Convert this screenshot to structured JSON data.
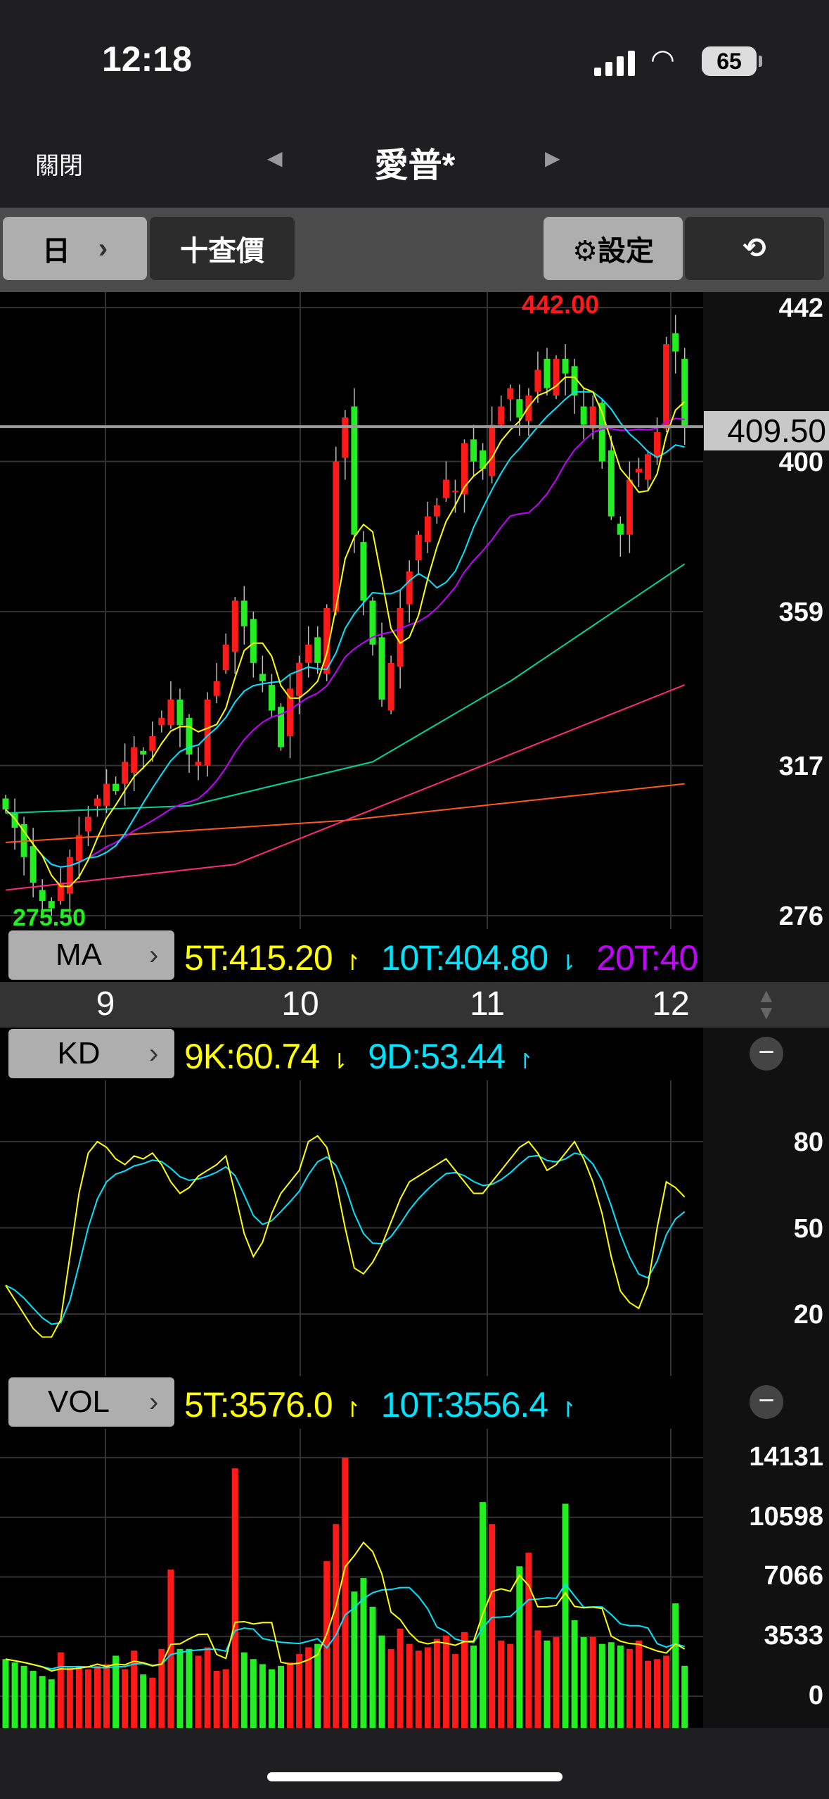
{
  "status": {
    "time": "12:18",
    "battery": "65"
  },
  "nav": {
    "close": "關閉",
    "title": "愛普*",
    "prev": "◀",
    "next": "▶"
  },
  "toolbar": {
    "period": "日",
    "period_arrow": "›",
    "add_price": "十查價",
    "settings": "⚙設定",
    "rotate": "⟲"
  },
  "price_axis": {
    "labels": [
      "442",
      "400",
      "359",
      "317",
      "276"
    ],
    "last": "409.50",
    "high_label": "442.00",
    "low_label": "275.50"
  },
  "ma": {
    "tag": "MA",
    "arrow": "›",
    "items": [
      {
        "text": "5T:415.20",
        "color": "#ffff00"
      },
      {
        "text": "10T:404.80",
        "color": "#00e5ff"
      },
      {
        "text": "20T:40",
        "color": "#c400ff"
      }
    ],
    "arrows": [
      "↾",
      "⇂",
      ""
    ]
  },
  "x_axis": {
    "labels": [
      "9",
      "10",
      "11",
      "12"
    ]
  },
  "kd": {
    "tag": "KD",
    "arrow": "›",
    "items": [
      {
        "text": "9K:60.74",
        "color": "#ffff00"
      },
      {
        "text": "9D:53.44",
        "color": "#00e5ff"
      }
    ],
    "arrows": [
      "⇂",
      "↾"
    ],
    "axis": [
      "80",
      "50",
      "20"
    ],
    "collapse": "−"
  },
  "vol": {
    "tag": "VOL",
    "arrow": "›",
    "items": [
      {
        "text": "5T:3576.0",
        "color": "#ffff00"
      },
      {
        "text": "10T:3556.4",
        "color": "#00e5ff"
      }
    ],
    "arrows": [
      "↾",
      "↾"
    ],
    "axis": [
      "14131",
      "10598",
      "7066",
      "3533",
      "0"
    ],
    "collapse": "−"
  },
  "colors": {
    "up": "#ff1a1a",
    "down": "#22ee22",
    "ma5": "#ffff00",
    "ma10": "#00e5ff",
    "ma20": "#c400ff",
    "ma60": "#00d49a",
    "ma120": "#ff2a7a",
    "ma240": "#ff5a1a",
    "last_line": "#999999"
  },
  "chart_data": {
    "type": "candlestick",
    "price_range": [
      276,
      442
    ],
    "closes": [
      305,
      300,
      292,
      285,
      280,
      278,
      285,
      292,
      298,
      303,
      308,
      312,
      310,
      318,
      322,
      320,
      325,
      330,
      335,
      328,
      320,
      318,
      335,
      340,
      350,
      362,
      355,
      345,
      340,
      332,
      322,
      338,
      345,
      350,
      345,
      360,
      400,
      412,
      380,
      362,
      350,
      335,
      345,
      360,
      370,
      380,
      385,
      388,
      395,
      392,
      405,
      400,
      398,
      410,
      415,
      420,
      412,
      418,
      425,
      420,
      428,
      424,
      418,
      410,
      415,
      400,
      385,
      380,
      395,
      398,
      402,
      408,
      432,
      430,
      409.5
    ],
    "ma_long": {
      "ma60": [
        [
          0,
          304
        ],
        [
          20,
          306
        ],
        [
          40,
          318
        ],
        [
          55,
          340
        ],
        [
          74,
          372
        ]
      ],
      "ma120": [
        [
          0,
          283
        ],
        [
          25,
          290
        ],
        [
          50,
          315
        ],
        [
          74,
          339
        ]
      ],
      "ma240": [
        [
          0,
          296
        ],
        [
          37,
          302
        ],
        [
          74,
          312
        ]
      ]
    },
    "volumes": [
      2200,
      2000,
      1800,
      1500,
      1200,
      1000,
      2600,
      1700,
      1800,
      1600,
      1800,
      1900,
      2400,
      1600,
      2700,
      1300,
      1100,
      2800,
      7500,
      2800,
      2800,
      2400,
      2900,
      1500,
      1600,
      13500,
      2600,
      2200,
      1900,
      1600,
      1800,
      2000,
      2500,
      2900,
      3100,
      8000,
      10200,
      14131,
      6200,
      7000,
      5300,
      3600,
      2800,
      4000,
      3100,
      2700,
      2900,
      3400,
      3600,
      2500,
      3800,
      3000,
      11500,
      10200,
      3300,
      3100,
      7700,
      8500,
      3900,
      3300,
      3500,
      11400,
      4500,
      3500,
      3500,
      3100,
      3200,
      3000,
      2800,
      3300,
      2100,
      2200,
      2400,
      5500,
      1800
    ],
    "vol_range": [
      0,
      14131
    ],
    "k": [
      30,
      25,
      20,
      15,
      12,
      12,
      18,
      40,
      62,
      76,
      80,
      78,
      74,
      72,
      75,
      74,
      76,
      72,
      66,
      62,
      64,
      68,
      70,
      72,
      75,
      62,
      48,
      40,
      45,
      55,
      62,
      66,
      70,
      80,
      82,
      78,
      66,
      50,
      36,
      34,
      38,
      44,
      52,
      60,
      66,
      68,
      70,
      72,
      74,
      70,
      66,
      62,
      62,
      66,
      70,
      74,
      78,
      80,
      76,
      70,
      72,
      76,
      80,
      74,
      66,
      55,
      40,
      28,
      24,
      22,
      30,
      50,
      66,
      64,
      60.74
    ],
    "kd_range": [
      0,
      100
    ]
  }
}
